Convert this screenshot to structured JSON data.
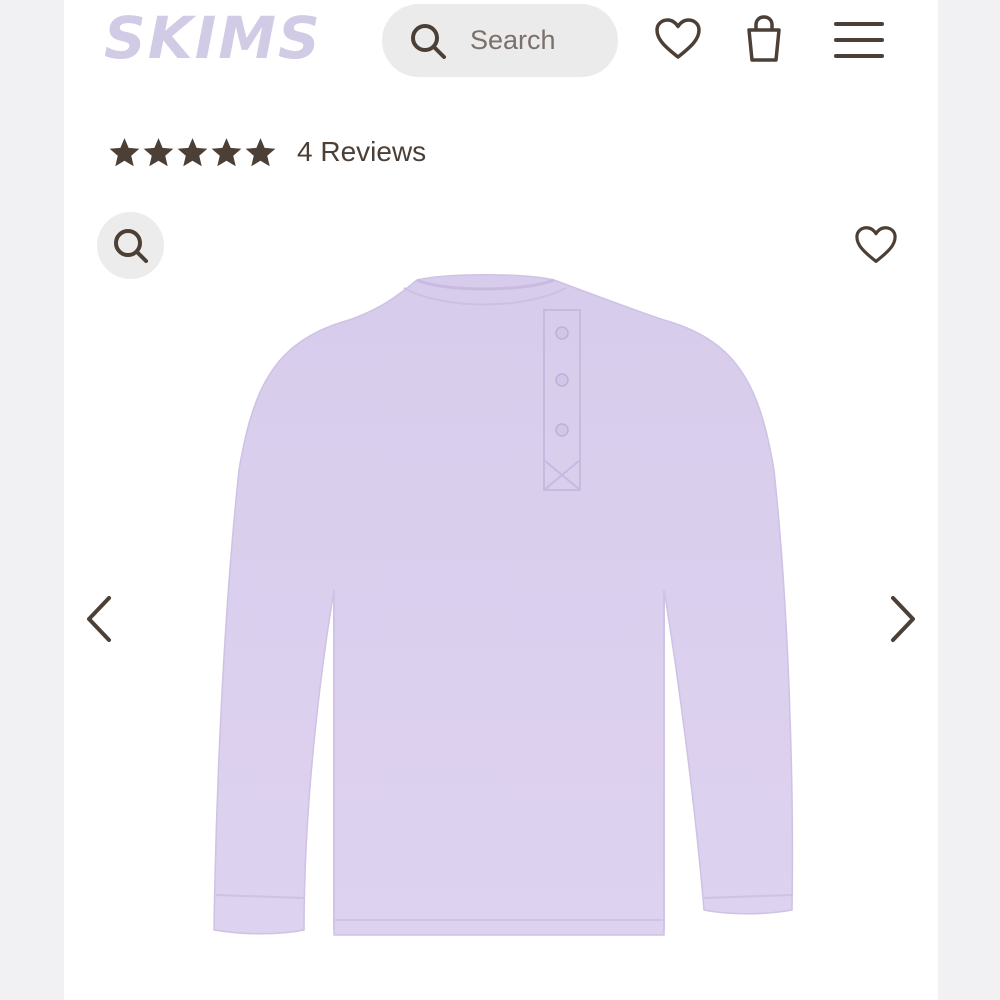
{
  "brand": {
    "logo_text": "SKIMS",
    "logo_color": "#d2cbe6"
  },
  "header": {
    "search_label": "Search",
    "icons": [
      "search-icon",
      "heart-icon",
      "shopping-bag-icon",
      "menu-icon"
    ]
  },
  "product": {
    "rating": 5,
    "rating_max": 5,
    "reviews_label": "4 Reviews",
    "image": {
      "description_icon": "lavender-henley-shirt",
      "color": "#dcd0ee"
    }
  },
  "gallery": {
    "zoom_icon": "search-icon",
    "wishlist_icon": "heart-icon",
    "prev_icon": "chevron-left-icon",
    "next_icon": "chevron-right-icon"
  },
  "theme": {
    "text": "#4b3f36",
    "search_bg": "#ebebeb",
    "shirt": "#dcd0ee"
  }
}
